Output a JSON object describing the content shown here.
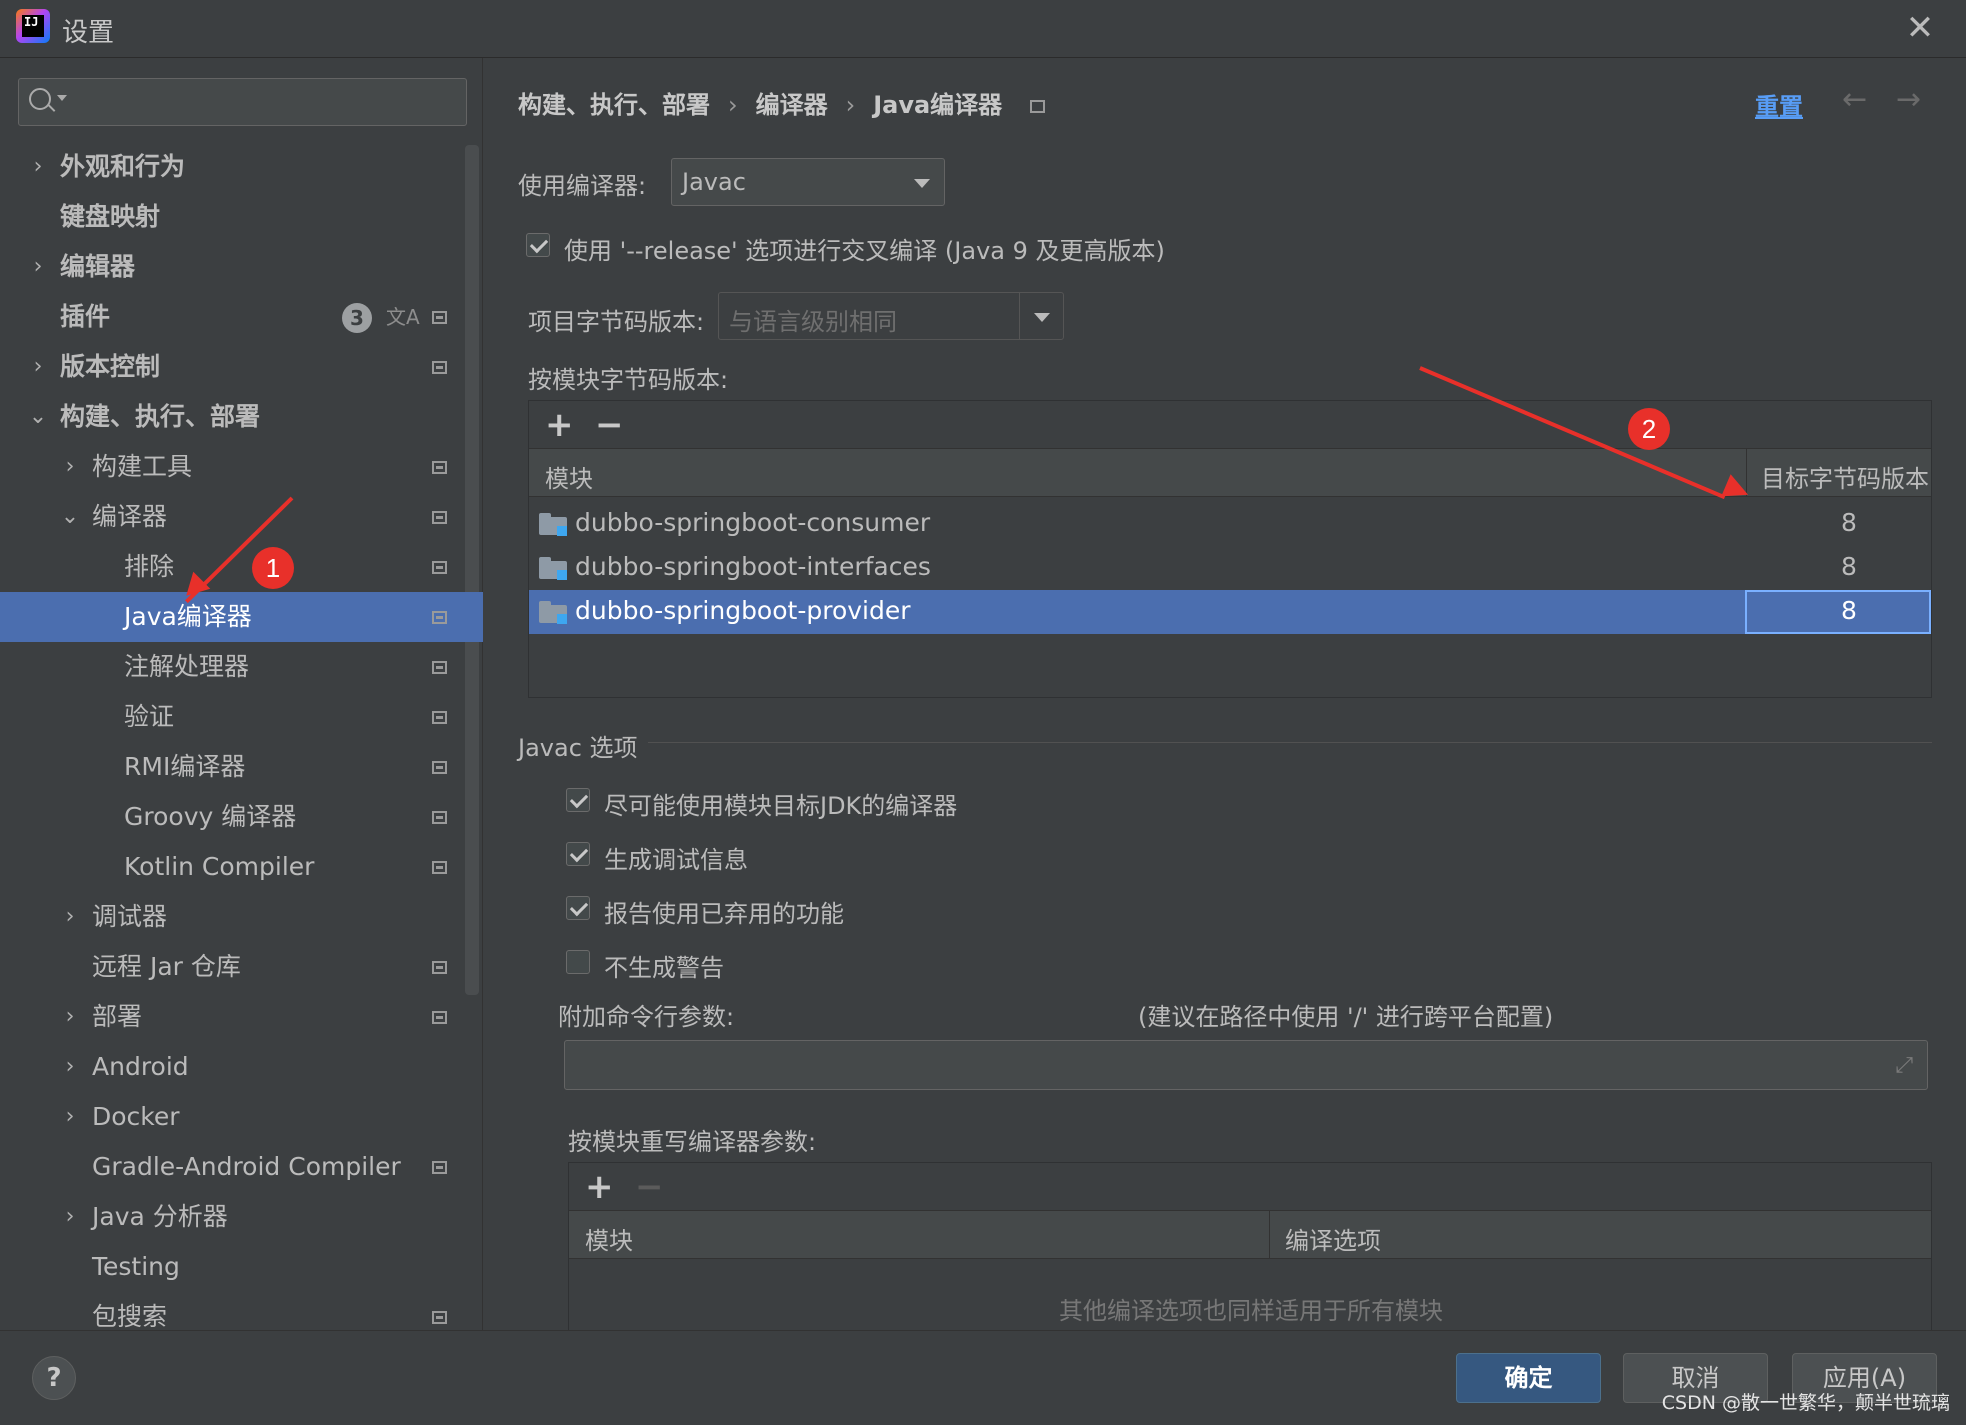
{
  "window": {
    "title": "设置",
    "app_icon_text": "IJ"
  },
  "sidebar": {
    "search": {
      "placeholder": "",
      "value": ""
    },
    "items": [
      {
        "label": "外观和行为",
        "level": 0,
        "arrow": "›",
        "bold": true
      },
      {
        "label": "键盘映射",
        "level": 0,
        "arrow": "",
        "bold": true
      },
      {
        "label": "编辑器",
        "level": 0,
        "arrow": "›",
        "bold": true
      },
      {
        "label": "插件",
        "level": 0,
        "arrow": "",
        "bold": true,
        "badge": "3"
      },
      {
        "label": "版本控制",
        "level": 0,
        "arrow": "›",
        "bold": true
      },
      {
        "label": "构建、执行、部署",
        "level": 0,
        "arrow": "⌄",
        "bold": true
      },
      {
        "label": "构建工具",
        "level": 1,
        "arrow": "›"
      },
      {
        "label": "编译器",
        "level": 1,
        "arrow": "⌄"
      },
      {
        "label": "排除",
        "level": 2,
        "arrow": ""
      },
      {
        "label": "Java编译器",
        "level": 2,
        "arrow": "",
        "selected": true
      },
      {
        "label": "注解处理器",
        "level": 2,
        "arrow": ""
      },
      {
        "label": "验证",
        "level": 2,
        "arrow": ""
      },
      {
        "label": "RMI编译器",
        "level": 2,
        "arrow": ""
      },
      {
        "label": "Groovy 编译器",
        "level": 2,
        "arrow": ""
      },
      {
        "label": "Kotlin Compiler",
        "level": 2,
        "arrow": ""
      },
      {
        "label": "调试器",
        "level": 1,
        "arrow": "›"
      },
      {
        "label": "远程 Jar 仓库",
        "level": 1,
        "arrow": ""
      },
      {
        "label": "部署",
        "level": 1,
        "arrow": "›"
      },
      {
        "label": "Android",
        "level": 1,
        "arrow": "›"
      },
      {
        "label": "Docker",
        "level": 1,
        "arrow": "›"
      },
      {
        "label": "Gradle-Android Compiler",
        "level": 1,
        "arrow": ""
      },
      {
        "label": "Java 分析器",
        "level": 1,
        "arrow": "›"
      },
      {
        "label": "Testing",
        "level": 1,
        "arrow": ""
      },
      {
        "label": "包搜索",
        "level": 1,
        "arrow": ""
      }
    ]
  },
  "breadcrumb": [
    "构建、执行、部署",
    "编译器",
    "Java编译器"
  ],
  "header": {
    "reset_label": "重置",
    "back": "←",
    "forward": "→"
  },
  "compiler": {
    "use_label": "使用编译器:",
    "use_value": "Javac",
    "release_checkbox": {
      "label": "使用 '--release' 选项进行交叉编译 (Java 9 及更高版本)",
      "checked": true
    },
    "bytecode_label": "项目字节码版本:",
    "bytecode_value": "与语言级别相同",
    "per_module_label": "按模块字节码版本:",
    "per_module_table": {
      "col_module": "模块",
      "col_target": "目标字节码版本",
      "rows": [
        {
          "module": "dubbo-springboot-consumer",
          "target": "8"
        },
        {
          "module": "dubbo-springboot-interfaces",
          "target": "8"
        },
        {
          "module": "dubbo-springboot-provider",
          "target": "8",
          "selected": true
        }
      ]
    }
  },
  "javac": {
    "section_title": "Javac 选项",
    "options": [
      {
        "label": "尽可能使用模块目标JDK的编译器",
        "checked": true
      },
      {
        "label": "生成调试信息",
        "checked": true
      },
      {
        "label": "报告使用已弃用的功能",
        "checked": true
      },
      {
        "label": "不生成警告",
        "checked": false
      }
    ],
    "extra_args_label": "附加命令行参数:",
    "extra_args_hint": "(建议在路径中使用 '/' 进行跨平台配置)",
    "extra_args_value": "",
    "override_label": "按模块重写编译器参数:",
    "override_table": {
      "col_module": "模块",
      "col_options": "编译选项",
      "empty_text": "其他编译选项也同样适用于所有模块"
    }
  },
  "footer": {
    "help": "?",
    "ok": "确定",
    "cancel": "取消",
    "apply": "应用(A)"
  },
  "annotations": {
    "marker1": "1",
    "marker2": "2",
    "color": "#e8302a"
  },
  "watermark": "CSDN @散一世繁华，颠半世琉璃",
  "colors": {
    "selection": "#4b6eaf",
    "link": "#589df6",
    "primary_button": "#365880",
    "background": "#3c3f41"
  }
}
